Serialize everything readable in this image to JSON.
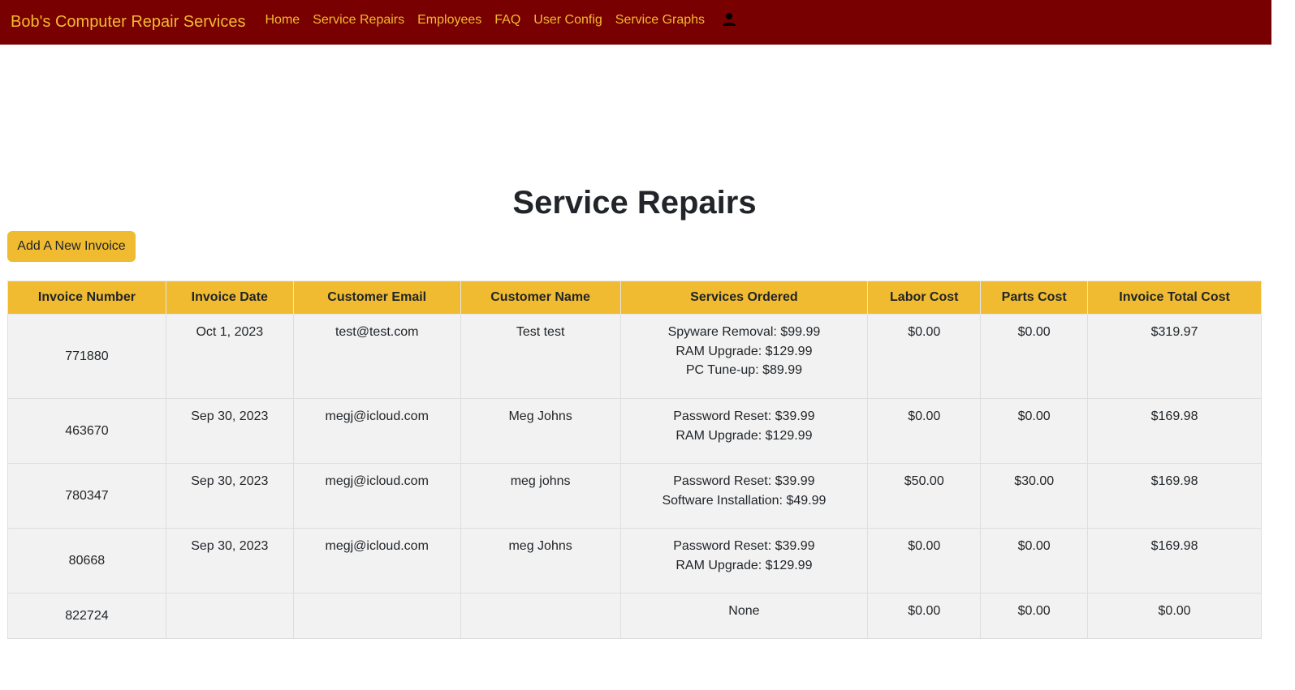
{
  "nav": {
    "brand": "Bob's Computer Repair Services",
    "links": [
      "Home",
      "Service Repairs",
      "Employees",
      "FAQ",
      "User Config",
      "Service Graphs"
    ],
    "user_icon": "person-icon"
  },
  "page": {
    "title": "Service Repairs",
    "add_button": "Add A New Invoice"
  },
  "colors": {
    "navbar": "#790000",
    "accent": "#f0bb30"
  },
  "table": {
    "headers": [
      "Invoice Number",
      "Invoice Date",
      "Customer Email",
      "Customer Name",
      "Services Ordered",
      "Labor Cost",
      "Parts Cost",
      "Invoice Total Cost"
    ],
    "rows": [
      {
        "number": "771880",
        "date": "Oct 1, 2023",
        "email": "test@test.com",
        "name": "Test test",
        "services": [
          "Spyware Removal: $99.99",
          "RAM Upgrade: $129.99",
          "PC Tune-up: $89.99"
        ],
        "labor": "$0.00",
        "parts": "$0.00",
        "total": "$319.97"
      },
      {
        "number": "463670",
        "date": "Sep 30, 2023",
        "email": "megj@icloud.com",
        "name": "Meg Johns",
        "services": [
          "Password Reset: $39.99",
          "RAM Upgrade: $129.99"
        ],
        "labor": "$0.00",
        "parts": "$0.00",
        "total": "$169.98"
      },
      {
        "number": "780347",
        "date": "Sep 30, 2023",
        "email": "megj@icloud.com",
        "name": "meg johns",
        "services": [
          "Password Reset: $39.99",
          "Software Installation: $49.99"
        ],
        "labor": "$50.00",
        "parts": "$30.00",
        "total": "$169.98"
      },
      {
        "number": "80668",
        "date": "Sep 30, 2023",
        "email": "megj@icloud.com",
        "name": "meg Johns",
        "services": [
          "Password Reset: $39.99",
          "RAM Upgrade: $129.99"
        ],
        "labor": "$0.00",
        "parts": "$0.00",
        "total": "$169.98"
      },
      {
        "number": "822724",
        "date": "",
        "email": "",
        "name": "",
        "services": [
          "None"
        ],
        "labor": "$0.00",
        "parts": "$0.00",
        "total": "$0.00"
      }
    ]
  }
}
